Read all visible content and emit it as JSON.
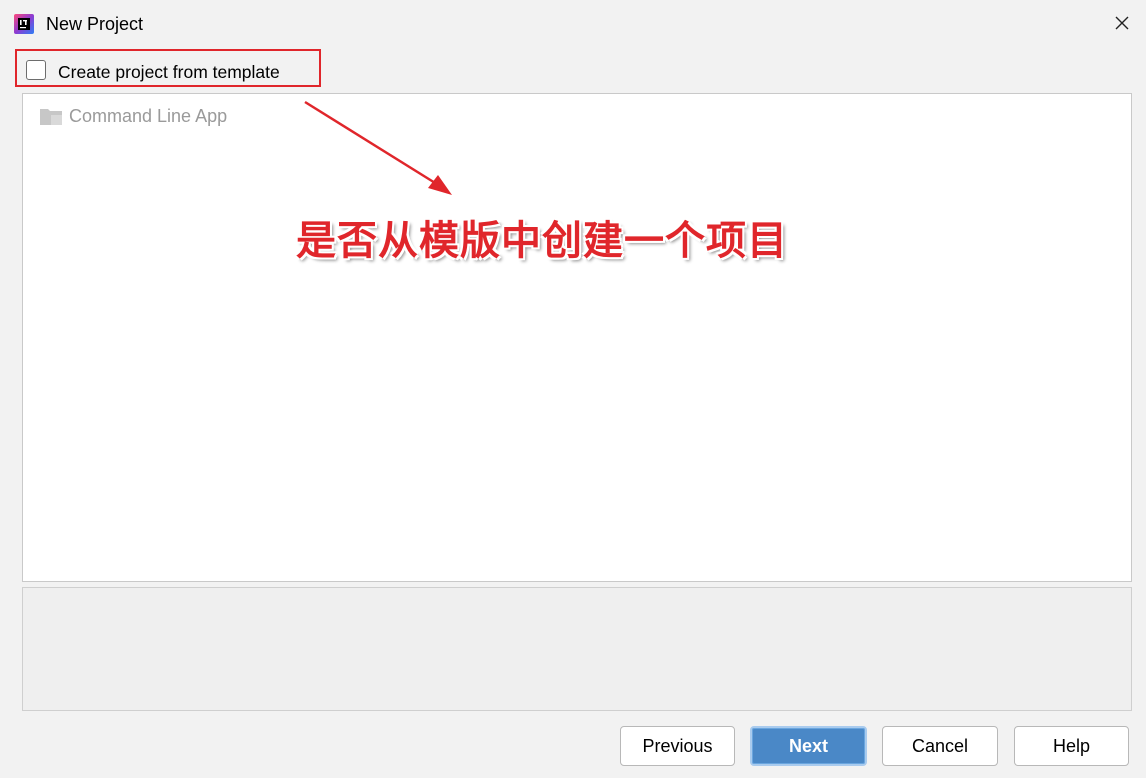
{
  "window": {
    "title": "New Project",
    "app_icon": "intellij-idea-icon",
    "close_icon": "close-icon"
  },
  "template_option": {
    "label": "Create project from template",
    "checked": false
  },
  "templates": [
    {
      "label": "Command Line App",
      "icon": "folder-icon"
    }
  ],
  "annotation": {
    "text": "是否从模版中创建一个项目",
    "color": "#e0262b"
  },
  "buttons": {
    "previous": "Previous",
    "next": "Next",
    "cancel": "Cancel",
    "help": "Help"
  },
  "colors": {
    "primary_button": "#4a88c7",
    "highlight_box": "#e0262b"
  }
}
